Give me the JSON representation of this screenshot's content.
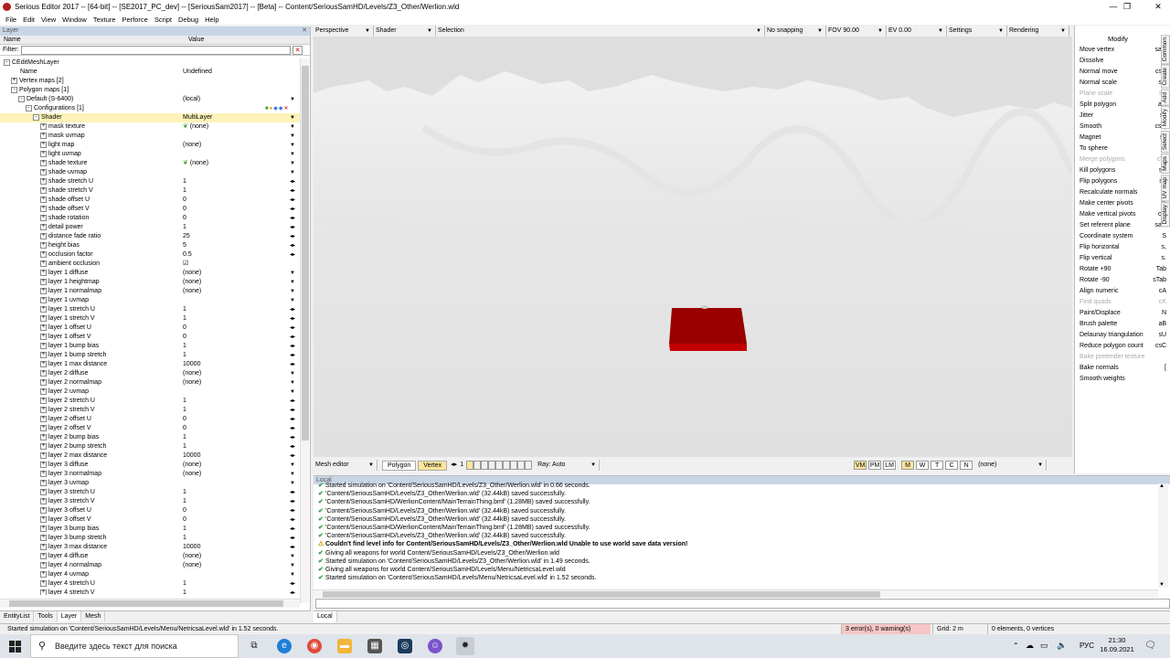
{
  "window": {
    "title": "Serious Editor 2017 -- [64-bit] -- [SE2017_PC_dev] -- [SeriousSam2017] -- [Beta] -- Content/SeriousSamHD/Levels/Z3_Other/Werlion.wld",
    "minimize": "—",
    "maximize": "❐",
    "close": "✕"
  },
  "menu": [
    "File",
    "Edit",
    "View",
    "Window",
    "Texture",
    "Perforce",
    "Script",
    "Debug",
    "Help"
  ],
  "layer_panel": {
    "header": "Layer",
    "col_name": "Name",
    "col_value": "Value",
    "filter_label": "Filter:",
    "filter_value": "",
    "tree": [
      {
        "indent": 0,
        "pm": "-",
        "name": "CEditMeshLayer",
        "value": ""
      },
      {
        "indent": 1,
        "pm": "",
        "name": "Name",
        "value": "Undefined"
      },
      {
        "indent": 1,
        "pm": "+",
        "name": "Vertex maps [2]",
        "value": ""
      },
      {
        "indent": 1,
        "pm": "-",
        "name": "Polygon maps [1]",
        "value": ""
      },
      {
        "indent": 2,
        "pm": "-",
        "name": "Default (S-6400)",
        "value": "(local)",
        "arrow": "▼"
      },
      {
        "indent": 3,
        "pm": "-",
        "name": "Configurations [1]",
        "value": "",
        "icons": true
      },
      {
        "indent": 4,
        "pm": "-",
        "name": "Shader",
        "value": "MultiLayer",
        "arrow": "▼",
        "hl": true
      },
      {
        "indent": 5,
        "pm": "+",
        "name": "mask texture",
        "value": "(none)",
        "leaf": true,
        "arrow": "▼"
      },
      {
        "indent": 5,
        "pm": "+",
        "name": "mask uvmap",
        "value": "",
        "arrow": "▼"
      },
      {
        "indent": 5,
        "pm": "+",
        "name": "light map",
        "value": "(none)",
        "arrow": "▼"
      },
      {
        "indent": 5,
        "pm": "+",
        "name": "light uvmap",
        "value": "",
        "arrow": "▼"
      },
      {
        "indent": 5,
        "pm": "+",
        "name": "shade texture",
        "value": "(none)",
        "leaf": true,
        "arrow": "▼"
      },
      {
        "indent": 5,
        "pm": "+",
        "name": "shade uvmap",
        "value": "",
        "arrow": "▼"
      },
      {
        "indent": 5,
        "pm": "+",
        "name": "shade stretch U",
        "value": "1",
        "arrow": "◂▸"
      },
      {
        "indent": 5,
        "pm": "+",
        "name": "shade stretch V",
        "value": "1",
        "arrow": "◂▸"
      },
      {
        "indent": 5,
        "pm": "+",
        "name": "shade offset U",
        "value": "0",
        "arrow": "◂▸"
      },
      {
        "indent": 5,
        "pm": "+",
        "name": "shade offset V",
        "value": "0",
        "arrow": "◂▸"
      },
      {
        "indent": 5,
        "pm": "+",
        "name": "shade rotation",
        "value": "0",
        "arrow": "◂▸"
      },
      {
        "indent": 5,
        "pm": "+",
        "name": "detail power",
        "value": "1",
        "arrow": "◂▸"
      },
      {
        "indent": 5,
        "pm": "+",
        "name": "distance fade ratio",
        "value": "25",
        "arrow": "◂▸"
      },
      {
        "indent": 5,
        "pm": "+",
        "name": "height bias",
        "value": "5",
        "arrow": "◂▸"
      },
      {
        "indent": 5,
        "pm": "+",
        "name": "occlusion factor",
        "value": "0.5",
        "arrow": "◂▸"
      },
      {
        "indent": 5,
        "pm": "+",
        "name": "ambient occlusion",
        "value": "☑",
        "arrow": ""
      },
      {
        "indent": 5,
        "pm": "+",
        "name": "layer 1 diffuse",
        "value": "(none)",
        "arrow": "▼"
      },
      {
        "indent": 5,
        "pm": "+",
        "name": "layer 1 heightmap",
        "value": "(none)",
        "arrow": "▼"
      },
      {
        "indent": 5,
        "pm": "+",
        "name": "layer 1 normalmap",
        "value": "(none)",
        "arrow": "▼"
      },
      {
        "indent": 5,
        "pm": "+",
        "name": "layer 1 uvmap",
        "value": "",
        "arrow": "▼"
      },
      {
        "indent": 5,
        "pm": "+",
        "name": "layer 1 stretch U",
        "value": "1",
        "arrow": "◂▸"
      },
      {
        "indent": 5,
        "pm": "+",
        "name": "layer 1 stretch V",
        "value": "1",
        "arrow": "◂▸"
      },
      {
        "indent": 5,
        "pm": "+",
        "name": "layer 1 offset U",
        "value": "0",
        "arrow": "◂▸"
      },
      {
        "indent": 5,
        "pm": "+",
        "name": "layer 1 offset V",
        "value": "0",
        "arrow": "◂▸"
      },
      {
        "indent": 5,
        "pm": "+",
        "name": "layer 1 bump bias",
        "value": "1",
        "arrow": "◂▸"
      },
      {
        "indent": 5,
        "pm": "+",
        "name": "layer 1 bump stretch",
        "value": "1",
        "arrow": "◂▸"
      },
      {
        "indent": 5,
        "pm": "+",
        "name": "layer 1 max distance",
        "value": "10000",
        "arrow": "◂▸"
      },
      {
        "indent": 5,
        "pm": "+",
        "name": "layer 2 diffuse",
        "value": "(none)",
        "arrow": "▼"
      },
      {
        "indent": 5,
        "pm": "+",
        "name": "layer 2 normalmap",
        "value": "(none)",
        "arrow": "▼"
      },
      {
        "indent": 5,
        "pm": "+",
        "name": "layer 2 uvmap",
        "value": "",
        "arrow": "▼"
      },
      {
        "indent": 5,
        "pm": "+",
        "name": "layer 2 stretch U",
        "value": "1",
        "arrow": "◂▸"
      },
      {
        "indent": 5,
        "pm": "+",
        "name": "layer 2 stretch V",
        "value": "1",
        "arrow": "◂▸"
      },
      {
        "indent": 5,
        "pm": "+",
        "name": "layer 2 offset U",
        "value": "0",
        "arrow": "◂▸"
      },
      {
        "indent": 5,
        "pm": "+",
        "name": "layer 2 offset V",
        "value": "0",
        "arrow": "◂▸"
      },
      {
        "indent": 5,
        "pm": "+",
        "name": "layer 2 bump bias",
        "value": "1",
        "arrow": "◂▸"
      },
      {
        "indent": 5,
        "pm": "+",
        "name": "layer 2 bump stretch",
        "value": "1",
        "arrow": "◂▸"
      },
      {
        "indent": 5,
        "pm": "+",
        "name": "layer 2 max distance",
        "value": "10000",
        "arrow": "◂▸"
      },
      {
        "indent": 5,
        "pm": "+",
        "name": "layer 3 diffuse",
        "value": "(none)",
        "arrow": "▼"
      },
      {
        "indent": 5,
        "pm": "+",
        "name": "layer 3 normalmap",
        "value": "(none)",
        "arrow": "▼"
      },
      {
        "indent": 5,
        "pm": "+",
        "name": "layer 3 uvmap",
        "value": "",
        "arrow": "▼"
      },
      {
        "indent": 5,
        "pm": "+",
        "name": "layer 3 stretch U",
        "value": "1",
        "arrow": "◂▸"
      },
      {
        "indent": 5,
        "pm": "+",
        "name": "layer 3 stretch V",
        "value": "1",
        "arrow": "◂▸"
      },
      {
        "indent": 5,
        "pm": "+",
        "name": "layer 3 offset U",
        "value": "0",
        "arrow": "◂▸"
      },
      {
        "indent": 5,
        "pm": "+",
        "name": "layer 3 offset V",
        "value": "0",
        "arrow": "◂▸"
      },
      {
        "indent": 5,
        "pm": "+",
        "name": "layer 3 bump bias",
        "value": "1",
        "arrow": "◂▸"
      },
      {
        "indent": 5,
        "pm": "+",
        "name": "layer 3 bump stretch",
        "value": "1",
        "arrow": "◂▸"
      },
      {
        "indent": 5,
        "pm": "+",
        "name": "layer 3 max distance",
        "value": "10000",
        "arrow": "◂▸"
      },
      {
        "indent": 5,
        "pm": "+",
        "name": "layer 4 diffuse",
        "value": "(none)",
        "arrow": "▼"
      },
      {
        "indent": 5,
        "pm": "+",
        "name": "layer 4 normalmap",
        "value": "(none)",
        "arrow": "▼"
      },
      {
        "indent": 5,
        "pm": "+",
        "name": "layer 4 uvmap",
        "value": "",
        "arrow": "▼"
      },
      {
        "indent": 5,
        "pm": "+",
        "name": "layer 4 stretch U",
        "value": "1",
        "arrow": "◂▸"
      },
      {
        "indent": 5,
        "pm": "+",
        "name": "layer 4 stretch V",
        "value": "1",
        "arrow": "◂▸"
      }
    ],
    "tabs": [
      "EntityList",
      "Tools",
      "Layer",
      "Mesh"
    ],
    "active_tab": "Layer"
  },
  "viewport_toolbar": {
    "view": "Perspective",
    "shader": "Shader",
    "selection": "Selection",
    "snapping": "No snapping",
    "fov": "FOV 90.00",
    "ev": "EV  0.00",
    "settings": "Settings",
    "rendering": "Rendering"
  },
  "viewport_bottom": {
    "editor": "Mesh editor",
    "modes": [
      "Polygon",
      "Vertex"
    ],
    "active_mode": "Vertex",
    "page": "1",
    "ray": "Ray: Auto",
    "toggles": [
      "VM",
      "PM",
      "LM",
      "M",
      "W",
      "T",
      "C",
      "N"
    ],
    "active_toggles": [
      "VM",
      "M"
    ],
    "none": "(none)"
  },
  "modify_panel": {
    "title": "Modify",
    "items": [
      {
        "label": "Move vertex",
        "key": "saD",
        "dis": false
      },
      {
        "label": "Dissolve",
        "key": "D",
        "dis": false
      },
      {
        "label": "Normal move",
        "key": "csN",
        "dis": false
      },
      {
        "label": "Normal scale",
        "key": "sN",
        "dis": false
      },
      {
        "label": "Plane scale",
        "key": "sS",
        "dis": true
      },
      {
        "label": "Split polygon",
        "key": "aN",
        "dis": false
      },
      {
        "label": "Jitter",
        "key": "sJ",
        "dis": false
      },
      {
        "label": "Smooth",
        "key": "csQ",
        "dis": false
      },
      {
        "label": "Magnet",
        "key": "sJ",
        "dis": false
      },
      {
        "label": "To sphere",
        "key": "",
        "dis": false
      },
      {
        "label": "Merge polygons",
        "key": "cW",
        "dis": true
      },
      {
        "label": "Kill polygons",
        "key": "sK",
        "dis": false
      },
      {
        "label": "Flip polygons",
        "key": "sF",
        "dis": false
      },
      {
        "label": "Recalculate normals",
        "key": "",
        "dis": false
      },
      {
        "label": "Make center pivots",
        "key": "c\\",
        "dis": false
      },
      {
        "label": "Make vertical pivots",
        "key": "cs\\",
        "dis": false
      },
      {
        "label": "Set referent plane",
        "key": "saC",
        "dis": false
      },
      {
        "label": "Coordinate system",
        "key": "S",
        "dis": false
      },
      {
        "label": "Flip horizontal",
        "key": "s,",
        "dis": false
      },
      {
        "label": "Flip vertical",
        "key": "s.",
        "dis": false
      },
      {
        "label": "Rotate +90",
        "key": "Tab",
        "dis": false
      },
      {
        "label": "Rotate -90",
        "key": "sTab",
        "dis": false
      },
      {
        "label": "Align numeric",
        "key": "cA",
        "dis": false
      },
      {
        "label": "Find quads",
        "key": "cK",
        "dis": true
      },
      {
        "label": "Paint/Displace",
        "key": "N",
        "dis": false
      },
      {
        "label": "Brush palette",
        "key": "aB",
        "dis": false
      },
      {
        "label": "Delaunay triangulation",
        "key": "sU",
        "dis": false
      },
      {
        "label": "Reduce polygon count",
        "key": "csC",
        "dis": false
      },
      {
        "label": "Bake pretender texture",
        "key": "",
        "dis": true
      },
      {
        "label": "Bake normals",
        "key": "[",
        "dis": false
      },
      {
        "label": "Smooth weights",
        "key": "",
        "dis": false
      }
    ],
    "side_tabs": [
      "Common",
      "Create",
      "Add",
      "Modify",
      "Select",
      "Maps",
      "UV map",
      "Display"
    ],
    "active_side_tab": "Modify"
  },
  "log": {
    "header": "Local",
    "lines": [
      {
        "t": "ok",
        "text": "Started simulation on 'Content/SeriousSamHD/Levels/Z3_Other/Werlion.wld' in 0.66 seconds."
      },
      {
        "t": "ok",
        "text": "'Content/SeriousSamHD/Levels/Z3_Other/Werlion.wld' (32.44kB) saved successfully."
      },
      {
        "t": "ok",
        "text": "'Content/SeriousSamHD/WerlionContent/MainTerrainThing.bmf' (1.28MB) saved successfully."
      },
      {
        "t": "ok",
        "text": "'Content/SeriousSamHD/Levels/Z3_Other/Werlion.wld' (32.44kB) saved successfully."
      },
      {
        "t": "ok",
        "text": "'Content/SeriousSamHD/Levels/Z3_Other/Werlion.wld' (32.44kB) saved successfully."
      },
      {
        "t": "ok",
        "text": "'Content/SeriousSamHD/WerlionContent/MainTerrainThing.bmf' (1.28MB) saved successfully."
      },
      {
        "t": "ok",
        "text": "'Content/SeriousSamHD/Levels/Z3_Other/Werlion.wld' (32.44kB) saved successfully."
      },
      {
        "t": "warn",
        "text": "Couldn't find level info for Content/SeriousSamHD/Levels/Z3_Other/Werlion.wld Unable to use world save data version!"
      },
      {
        "t": "ok",
        "text": "Giving all weapons for world Content/SeriousSamHD/Levels/Z3_Other/Werlion.wld"
      },
      {
        "t": "ok",
        "text": "Started simulation on 'Content/SeriousSamHD/Levels/Z3_Other/Werlion.wld' in 1.49 seconds."
      },
      {
        "t": "ok",
        "text": "Giving all weapons for world Content/SeriousSamHD/Levels/Menu/NetricsaLevel.wld"
      },
      {
        "t": "ok",
        "text": "Started simulation on 'Content/SeriousSamHD/Levels/Menu/NetricsaLevel.wld' in 1.52 seconds."
      }
    ],
    "tab": "Local"
  },
  "status": {
    "message": "Started simulation on 'Content/SeriousSamHD/Levels/Menu/NetricsaLevel.wld' in 1.52 seconds.",
    "errors": "3 error(s), 0 warning(s)",
    "grid": "Grid: 2 m",
    "elements": "0 elements, 0 vertices"
  },
  "taskbar": {
    "search_placeholder": "Введите здесь текст для поиска",
    "lang": "РУС",
    "time": "21:30",
    "date": "16.09.2021"
  },
  "colors": {
    "highlight": "#fdf3b8",
    "accent": "#c9d5e6",
    "object": "#a50000"
  }
}
